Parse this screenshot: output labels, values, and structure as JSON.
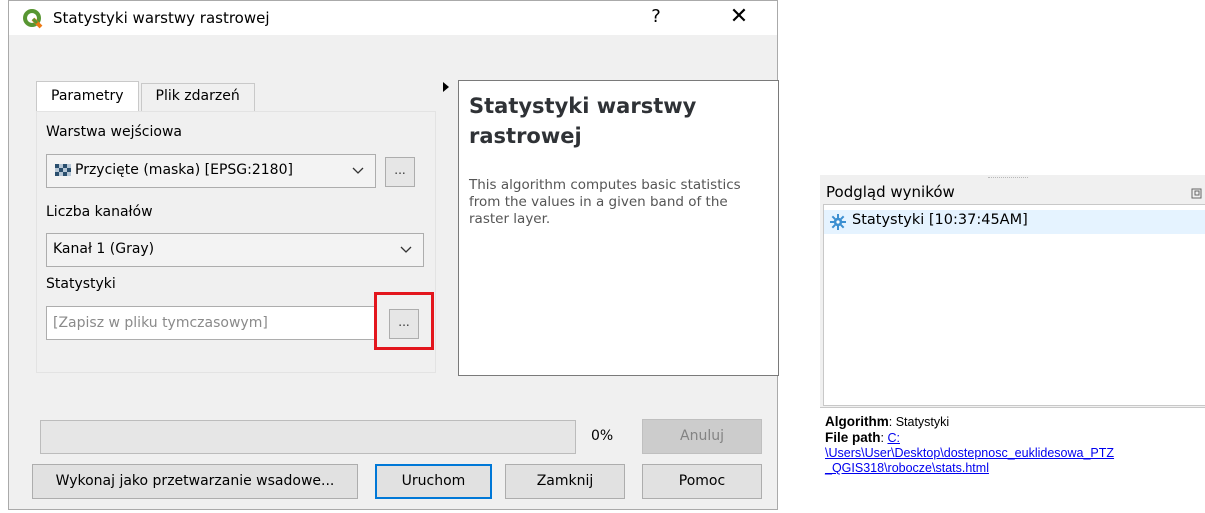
{
  "dialog": {
    "title": "Statystyki warstwy rastrowej",
    "help_glyph": "?",
    "close_glyph": "✕",
    "tabs": [
      {
        "label": "Parametry",
        "active": true
      },
      {
        "label": "Plik zdarzeń",
        "active": false
      }
    ],
    "params": {
      "input_layer_label": "Warstwa wejściowa",
      "input_layer_value": "Przycięte (maska) [EPSG:2180]",
      "band_label": "Liczba kanałów",
      "band_value": "Kanał 1 (Gray)",
      "stats_label": "Statystyki",
      "stats_placeholder": "[Zapisz w pliku tymczasowym]",
      "browse_label": "..."
    },
    "help": {
      "title": "Statystyki warstwy rastrowej",
      "description": "This algorithm computes basic statistics from the values in a given band of the raster layer."
    },
    "progress": {
      "value_percent": 0,
      "text": "0%"
    },
    "buttons": {
      "cancel": "Anuluj",
      "batch": "Wykonaj jako przetwarzanie wsadowe...",
      "run": "Uruchom",
      "close": "Zamknij",
      "help": "Pomoc"
    },
    "colors": {
      "highlight": "#e3161d",
      "default_button_border": "#0078d7"
    }
  },
  "results_viewer": {
    "title": "Podgląd wyników",
    "items": [
      {
        "label": "Statystyki [10:37:45AM]",
        "icon": "gear-icon"
      }
    ],
    "info": {
      "algorithm_key": "Algorithm",
      "algorithm_value": ": Statystyki",
      "file_path_key": "File path",
      "file_path_sep": ": ",
      "file_path_line1": "C:",
      "file_path_line2": "\\Users\\User\\Desktop\\dostepnosc_euklidesowa_PTZ",
      "file_path_line3": "_QGIS318\\robocze\\stats.html"
    }
  }
}
